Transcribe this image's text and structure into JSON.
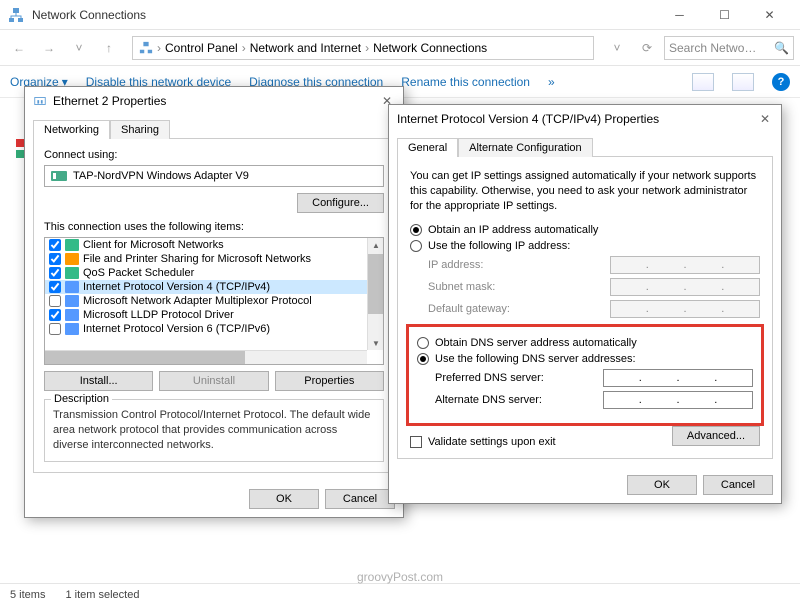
{
  "window": {
    "title": "Network Connections",
    "search_placeholder": "Search Netwo…"
  },
  "breadcrumb": [
    "Control Panel",
    "Network and Internet",
    "Network Connections"
  ],
  "cmdbar": {
    "organize": "Organize",
    "disable": "Disable this network device",
    "diagnose": "Diagnose this connection",
    "rename": "Rename this connection",
    "more": "»"
  },
  "eth_dialog": {
    "title": "Ethernet 2 Properties",
    "tabs": [
      "Networking",
      "Sharing"
    ],
    "connect_using_label": "Connect using:",
    "adapter": "TAP-NordVPN Windows Adapter V9",
    "configure_btn": "Configure...",
    "items_label": "This connection uses the following items:",
    "items": [
      {
        "checked": true,
        "name": "Client for Microsoft Networks"
      },
      {
        "checked": true,
        "name": "File and Printer Sharing for Microsoft Networks"
      },
      {
        "checked": true,
        "name": "QoS Packet Scheduler"
      },
      {
        "checked": true,
        "name": "Internet Protocol Version 4 (TCP/IPv4)",
        "selected": true
      },
      {
        "checked": false,
        "name": "Microsoft Network Adapter Multiplexor Protocol"
      },
      {
        "checked": true,
        "name": "Microsoft LLDP Protocol Driver"
      },
      {
        "checked": false,
        "name": "Internet Protocol Version 6 (TCP/IPv6)"
      }
    ],
    "install_btn": "Install...",
    "uninstall_btn": "Uninstall",
    "properties_btn": "Properties",
    "description_title": "Description",
    "description": "Transmission Control Protocol/Internet Protocol. The default wide area network protocol that provides communication across diverse interconnected networks.",
    "ok": "OK",
    "cancel": "Cancel"
  },
  "ipv4_dialog": {
    "title": "Internet Protocol Version 4 (TCP/IPv4) Properties",
    "tabs": [
      "General",
      "Alternate Configuration"
    ],
    "info": "You can get IP settings assigned automatically if your network supports this capability. Otherwise, you need to ask your network administrator for the appropriate IP settings.",
    "obtain_ip": "Obtain an IP address automatically",
    "use_ip": "Use the following IP address:",
    "ip_address": "IP address:",
    "subnet": "Subnet mask:",
    "gateway": "Default gateway:",
    "obtain_dns": "Obtain DNS server address automatically",
    "use_dns": "Use the following DNS server addresses:",
    "pref_dns": "Preferred DNS server:",
    "alt_dns": "Alternate DNS server:",
    "validate": "Validate settings upon exit",
    "advanced": "Advanced...",
    "ok": "OK",
    "cancel": "Cancel"
  },
  "statusbar": {
    "items": "5 items",
    "selected": "1 item selected"
  },
  "watermark": "groovyPost.com"
}
